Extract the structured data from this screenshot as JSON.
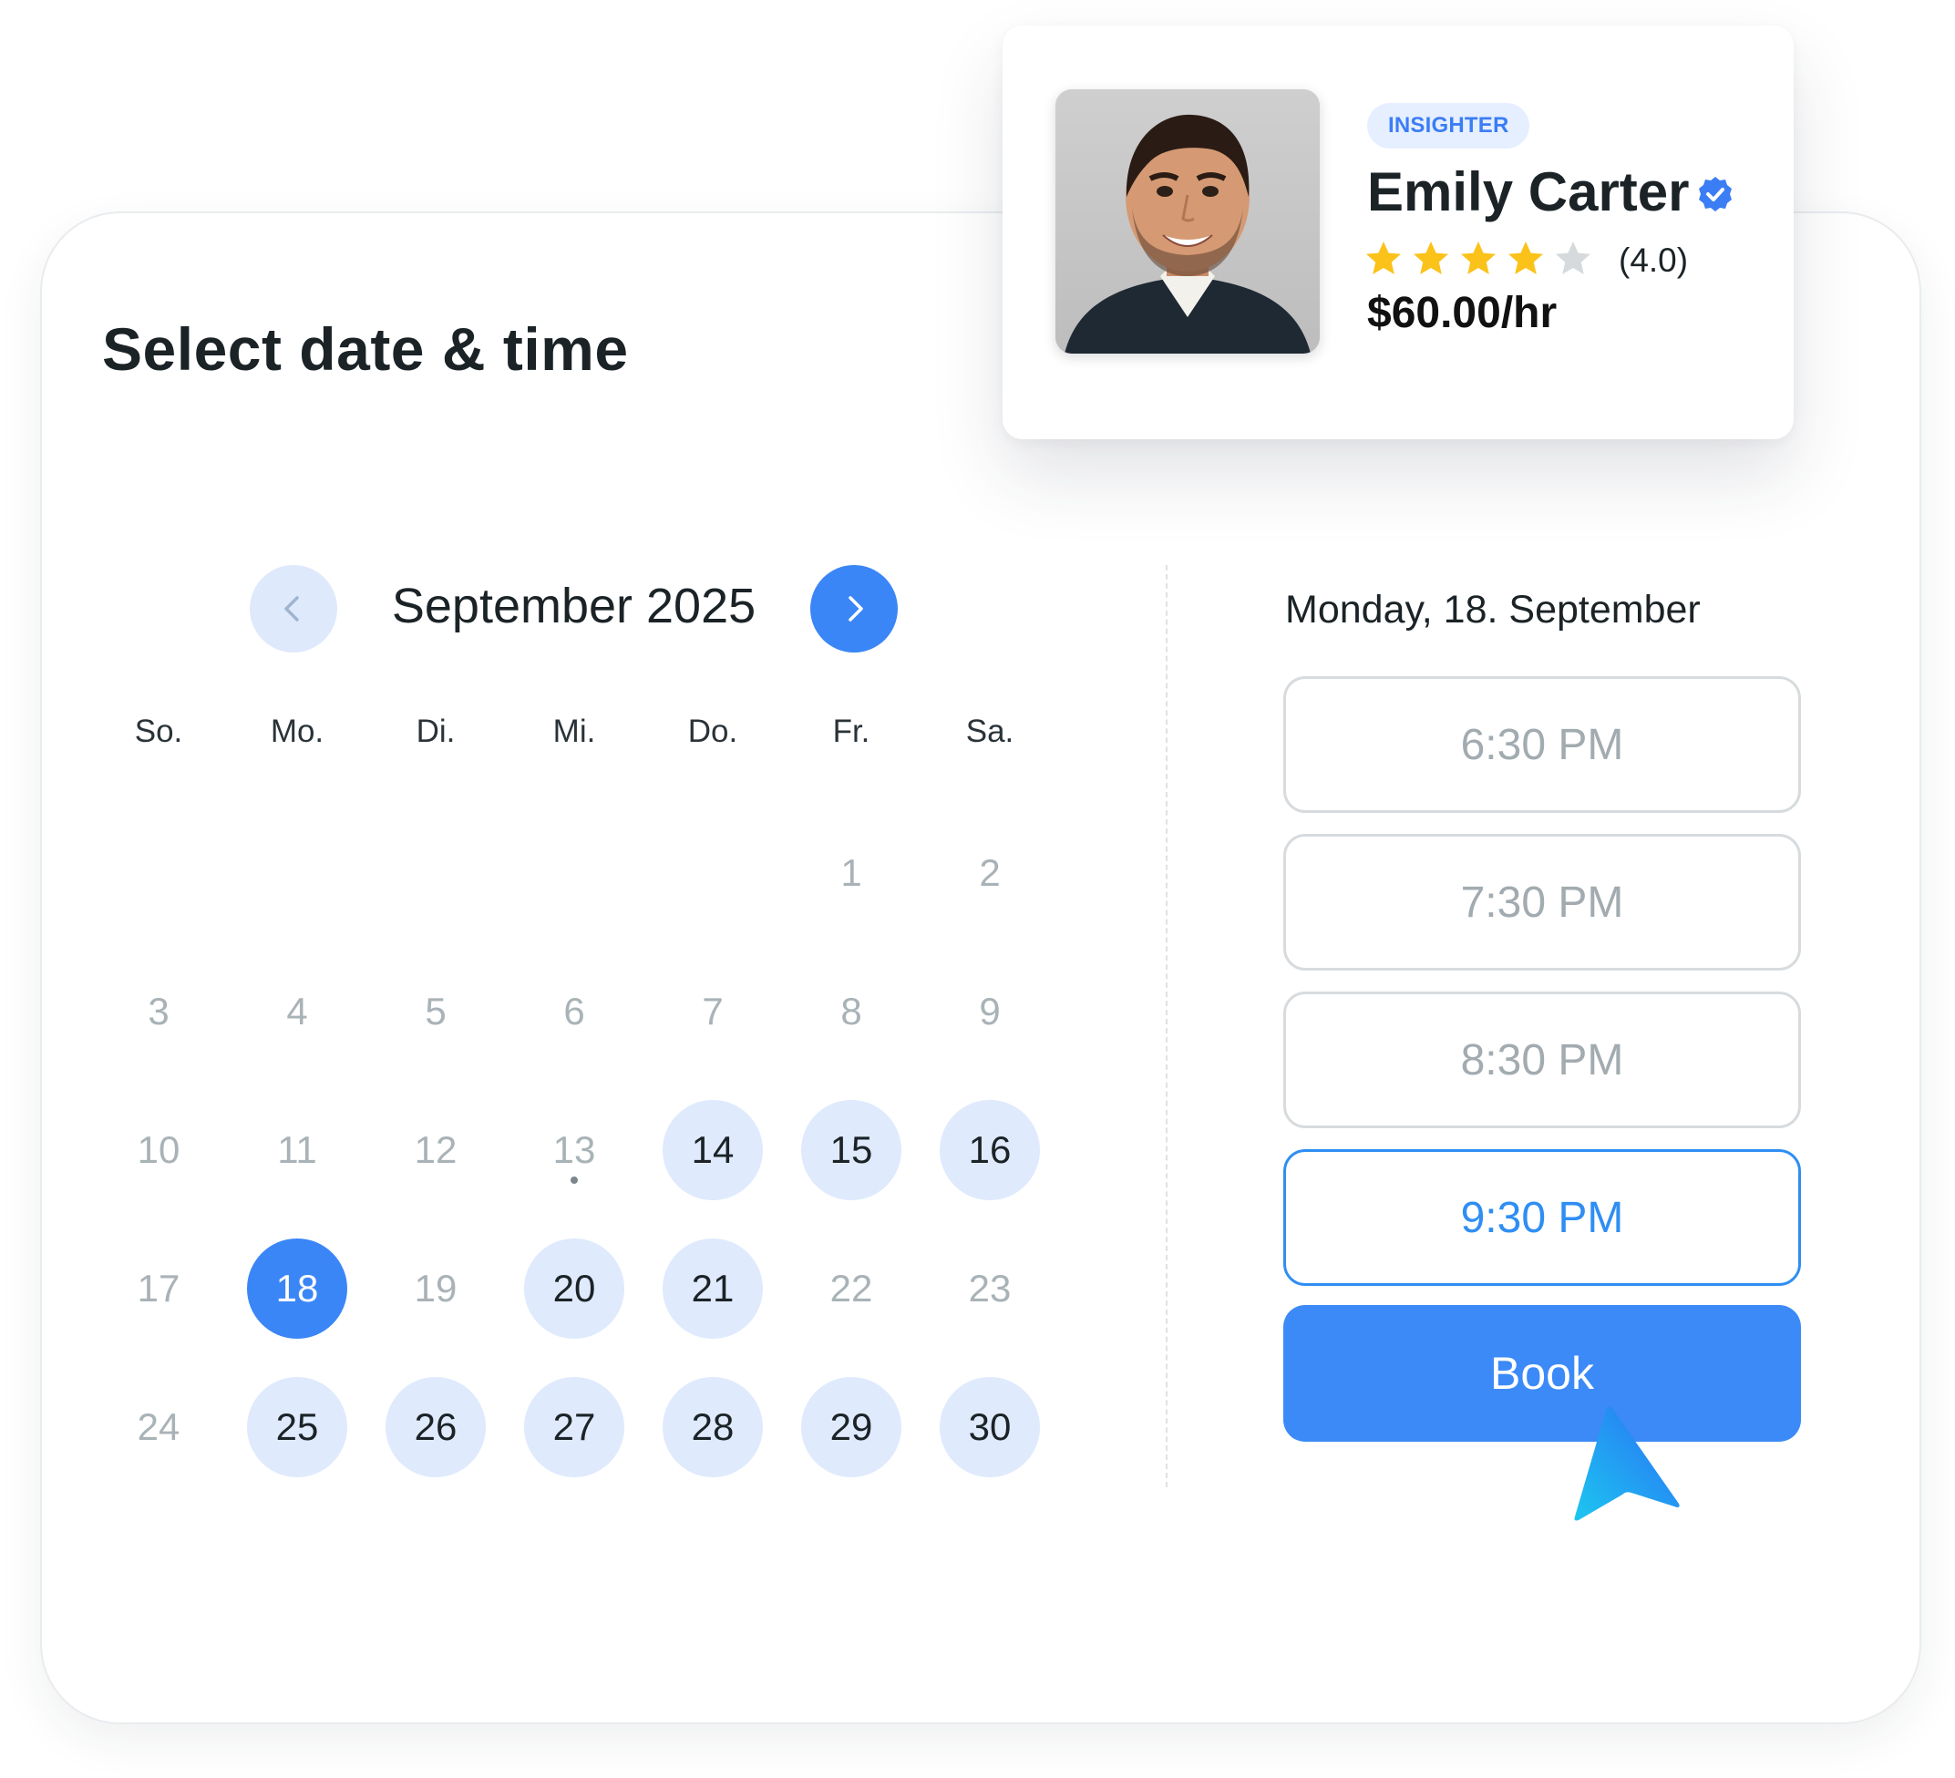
{
  "page": {
    "title": "Select date & time"
  },
  "profile": {
    "badge": "INSIGHTER",
    "name": "Emily Carter",
    "verified_icon": "verified-badge-icon",
    "rating": 4.0,
    "rating_text": "(4.0)",
    "stars_filled": 4,
    "stars_total": 5,
    "price": "$60.00/hr"
  },
  "calendar": {
    "month_label": "September 2025",
    "prev_icon": "chevron-left-icon",
    "next_icon": "chevron-right-icon",
    "weekdays": [
      "So.",
      "Mo.",
      "Di.",
      "Mi.",
      "Do.",
      "Fr.",
      "Sa."
    ],
    "days": [
      {
        "label": "1",
        "state": "disabled"
      },
      {
        "label": "2",
        "state": "disabled"
      },
      {
        "label": "3",
        "state": "disabled"
      },
      {
        "label": "4",
        "state": "disabled"
      },
      {
        "label": "5",
        "state": "disabled"
      },
      {
        "label": "6",
        "state": "disabled"
      },
      {
        "label": "7",
        "state": "disabled"
      },
      {
        "label": "8",
        "state": "disabled"
      },
      {
        "label": "9",
        "state": "disabled"
      },
      {
        "label": "10",
        "state": "disabled"
      },
      {
        "label": "11",
        "state": "disabled"
      },
      {
        "label": "12",
        "state": "disabled"
      },
      {
        "label": "13",
        "state": "disabled",
        "today": true
      },
      {
        "label": "14",
        "state": "available"
      },
      {
        "label": "15",
        "state": "available"
      },
      {
        "label": "16",
        "state": "available"
      },
      {
        "label": "17",
        "state": "disabled"
      },
      {
        "label": "18",
        "state": "selected"
      },
      {
        "label": "19",
        "state": "disabled"
      },
      {
        "label": "20",
        "state": "available"
      },
      {
        "label": "21",
        "state": "available"
      },
      {
        "label": "22",
        "state": "disabled"
      },
      {
        "label": "23",
        "state": "disabled"
      },
      {
        "label": "24",
        "state": "disabled"
      },
      {
        "label": "25",
        "state": "available"
      },
      {
        "label": "26",
        "state": "available"
      },
      {
        "label": "27",
        "state": "available"
      },
      {
        "label": "28",
        "state": "available"
      },
      {
        "label": "29",
        "state": "available"
      },
      {
        "label": "30",
        "state": "available"
      }
    ]
  },
  "times": {
    "date_heading": "Monday, 18. September",
    "slots": [
      {
        "label": "6:30 PM",
        "active": false
      },
      {
        "label": "7:30 PM",
        "active": false
      },
      {
        "label": "8:30 PM",
        "active": false
      },
      {
        "label": "9:30 PM",
        "active": true
      }
    ],
    "book_label": "Book"
  },
  "colors": {
    "accent": "#3b86f6",
    "available_bg": "#dfeafd",
    "star": "#fbc21a",
    "star_empty": "#d6dadc"
  }
}
